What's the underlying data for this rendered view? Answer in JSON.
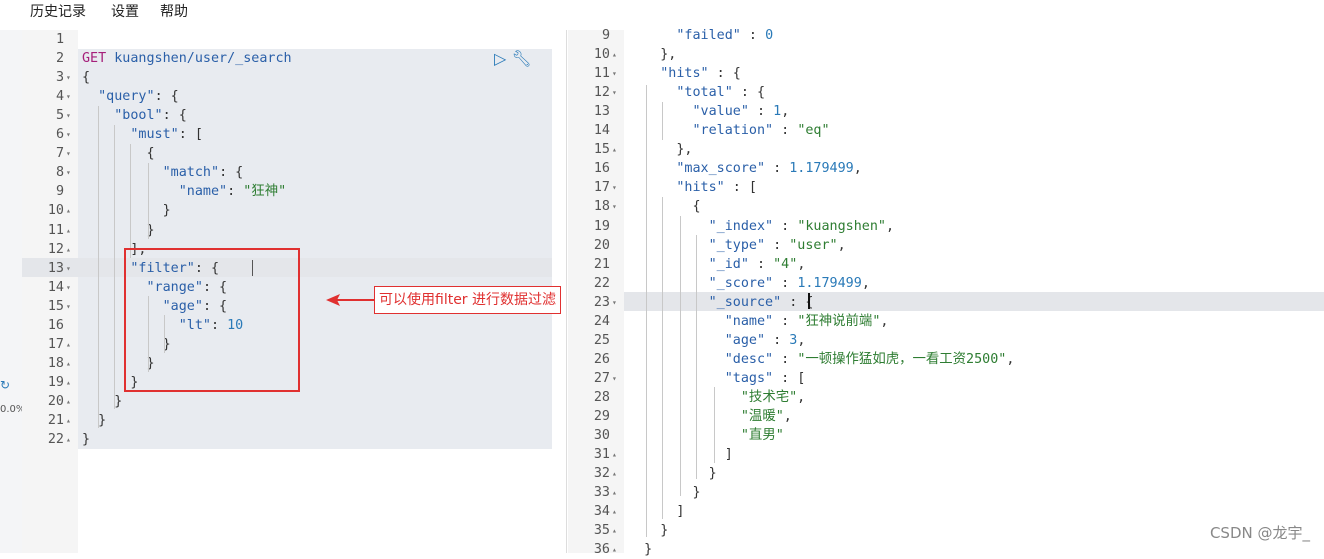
{
  "menu": {
    "history": "历史记录",
    "settings": "设置",
    "help": "帮助"
  },
  "sidebar": {
    "percent": "0.0%"
  },
  "request": {
    "lines": [
      {
        "n": "1",
        "fold": "",
        "code": ""
      },
      {
        "n": "2",
        "fold": "",
        "code": "GET kuangshen/user/_search"
      },
      {
        "n": "3",
        "fold": "▾",
        "code": "{"
      },
      {
        "n": "4",
        "fold": "▾",
        "code": "  \"query\": {"
      },
      {
        "n": "5",
        "fold": "▾",
        "code": "    \"bool\": {"
      },
      {
        "n": "6",
        "fold": "▾",
        "code": "      \"must\": ["
      },
      {
        "n": "7",
        "fold": "▾",
        "code": "        {"
      },
      {
        "n": "8",
        "fold": "▾",
        "code": "          \"match\": {"
      },
      {
        "n": "9",
        "fold": "",
        "code": "            \"name\": \"狂神\""
      },
      {
        "n": "10",
        "fold": "▴",
        "code": "          }"
      },
      {
        "n": "11",
        "fold": "▴",
        "code": "        }"
      },
      {
        "n": "12",
        "fold": "▴",
        "code": "      ],"
      },
      {
        "n": "13",
        "fold": "▾",
        "code": "      \"filter\": {"
      },
      {
        "n": "14",
        "fold": "▾",
        "code": "        \"range\": {"
      },
      {
        "n": "15",
        "fold": "▾",
        "code": "          \"age\": {"
      },
      {
        "n": "16",
        "fold": "",
        "code": "            \"lt\": 10"
      },
      {
        "n": "17",
        "fold": "▴",
        "code": "          }"
      },
      {
        "n": "18",
        "fold": "▴",
        "code": "        }"
      },
      {
        "n": "19",
        "fold": "▴",
        "code": "      }"
      },
      {
        "n": "20",
        "fold": "▴",
        "code": "    }"
      },
      {
        "n": "21",
        "fold": "▴",
        "code": "  }"
      },
      {
        "n": "22",
        "fold": "▴",
        "code": "}"
      }
    ]
  },
  "response": {
    "lines": [
      {
        "n": "9",
        "fold": "",
        "code": "      \"failed\" : 0"
      },
      {
        "n": "10",
        "fold": "▴",
        "code": "    },"
      },
      {
        "n": "11",
        "fold": "▾",
        "code": "    \"hits\" : {"
      },
      {
        "n": "12",
        "fold": "▾",
        "code": "      \"total\" : {"
      },
      {
        "n": "13",
        "fold": "",
        "code": "        \"value\" : 1,"
      },
      {
        "n": "14",
        "fold": "",
        "code": "        \"relation\" : \"eq\""
      },
      {
        "n": "15",
        "fold": "▴",
        "code": "      },"
      },
      {
        "n": "16",
        "fold": "",
        "code": "      \"max_score\" : 1.179499,"
      },
      {
        "n": "17",
        "fold": "▾",
        "code": "      \"hits\" : ["
      },
      {
        "n": "18",
        "fold": "▾",
        "code": "        {"
      },
      {
        "n": "19",
        "fold": "",
        "code": "          \"_index\" : \"kuangshen\","
      },
      {
        "n": "20",
        "fold": "",
        "code": "          \"_type\" : \"user\","
      },
      {
        "n": "21",
        "fold": "",
        "code": "          \"_id\" : \"4\","
      },
      {
        "n": "22",
        "fold": "",
        "code": "          \"_score\" : 1.179499,"
      },
      {
        "n": "23",
        "fold": "▾",
        "code": "          \"_source\" : {"
      },
      {
        "n": "24",
        "fold": "",
        "code": "            \"name\" : \"狂神说前端\","
      },
      {
        "n": "25",
        "fold": "",
        "code": "            \"age\" : 3,"
      },
      {
        "n": "26",
        "fold": "",
        "code": "            \"desc\" : \"一顿操作猛如虎，一看工资2500\","
      },
      {
        "n": "27",
        "fold": "▾",
        "code": "            \"tags\" : ["
      },
      {
        "n": "28",
        "fold": "",
        "code": "              \"技术宅\","
      },
      {
        "n": "29",
        "fold": "",
        "code": "              \"温暖\","
      },
      {
        "n": "30",
        "fold": "",
        "code": "              \"直男\""
      },
      {
        "n": "31",
        "fold": "▴",
        "code": "            ]"
      },
      {
        "n": "32",
        "fold": "▴",
        "code": "          }"
      },
      {
        "n": "33",
        "fold": "▴",
        "code": "        }"
      },
      {
        "n": "34",
        "fold": "▴",
        "code": "      ]"
      },
      {
        "n": "35",
        "fold": "▴",
        "code": "    }"
      },
      {
        "n": "36",
        "fold": "▴",
        "code": "  }"
      }
    ]
  },
  "annotation": {
    "callout": "可以使用filter 进行数据过滤"
  },
  "watermark": "CSDN @龙宇_",
  "colors": {
    "key": "#2a5fa8",
    "string": "#2e7d32",
    "number": "#2a7ab8",
    "method": "#a51f7a",
    "annotation": "#e03030"
  },
  "icons": {
    "run": "play-icon",
    "settings": "wrench-icon"
  }
}
